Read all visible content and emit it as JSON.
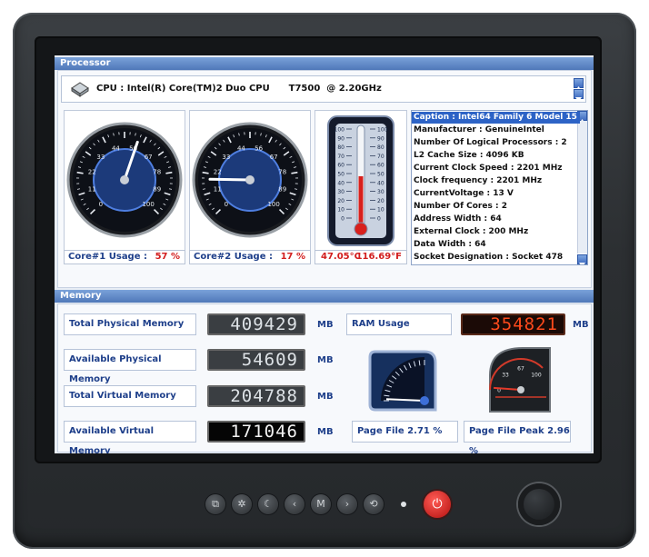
{
  "processor": {
    "section_title": "Processor",
    "cpu_name": "CPU : Intel(R) Core(TM)2 Duo CPU      T7500  @ 2.20GHz",
    "gauge_ticks": [
      "0",
      "11",
      "22",
      "33",
      "44",
      "56",
      "67",
      "78",
      "89",
      "100"
    ],
    "core1": {
      "label": "Core#1 Usage :",
      "value": "57 %",
      "usage_percent": 57
    },
    "core2": {
      "label": "Core#2 Usage :",
      "value": "17 %",
      "usage_percent": 17
    },
    "temperature": {
      "celsius": "47.05°C",
      "fahrenheit": "116.69°F",
      "scale_ticks": [
        "100",
        "90",
        "80",
        "70",
        "60",
        "50",
        "40",
        "30",
        "20",
        "10",
        "0"
      ],
      "level_percent": 47
    },
    "info_lines": [
      "Caption : Intel64 Family 6 Model 15",
      "Manufacturer : GenuineIntel",
      "Number Of Logical Processors : 2",
      "L2 Cache Size : 4096 KB",
      "Current Clock Speed : 2201 MHz",
      "Clock frequency : 2201 MHz",
      "CurrentVoltage : 13 V",
      "Number Of Cores : 2",
      "Address Width : 64",
      "External Clock : 200 MHz",
      "Data Width : 64",
      "Socket Designation : Socket 478"
    ]
  },
  "memory": {
    "section_title": "Memory",
    "unit": "MB",
    "total_physical": {
      "label": "Total Physical Memory",
      "value": "409429"
    },
    "available_physical": {
      "label": "Available Physical Memory",
      "value": "54609"
    },
    "total_virtual": {
      "label": "Total Virtual Memory",
      "value": "204788"
    },
    "available_virtual": {
      "label": "Available Virtual Memory",
      "value": "171046"
    },
    "ram_usage": {
      "label": "RAM Usage",
      "value": "354821"
    },
    "page_file": {
      "label": "Page File 2.71 %",
      "percent": 2.71
    },
    "page_file_peak": {
      "label": "Page File Peak 2.96 %",
      "percent": 2.96,
      "ticks": [
        "0",
        "33",
        "67",
        "100"
      ]
    }
  },
  "hardware_buttons": [
    "input-icon",
    "brightness-icon",
    "contrast-icon",
    "left-arrow-icon",
    "menu-icon",
    "right-arrow-icon",
    "auto-icon"
  ],
  "hardware_glyphs": {
    "input": "⧉",
    "brightness": "✲",
    "contrast": "☾",
    "left": "‹",
    "menu": "M",
    "right": "›",
    "auto": "⟲",
    "power": "⏻"
  }
}
